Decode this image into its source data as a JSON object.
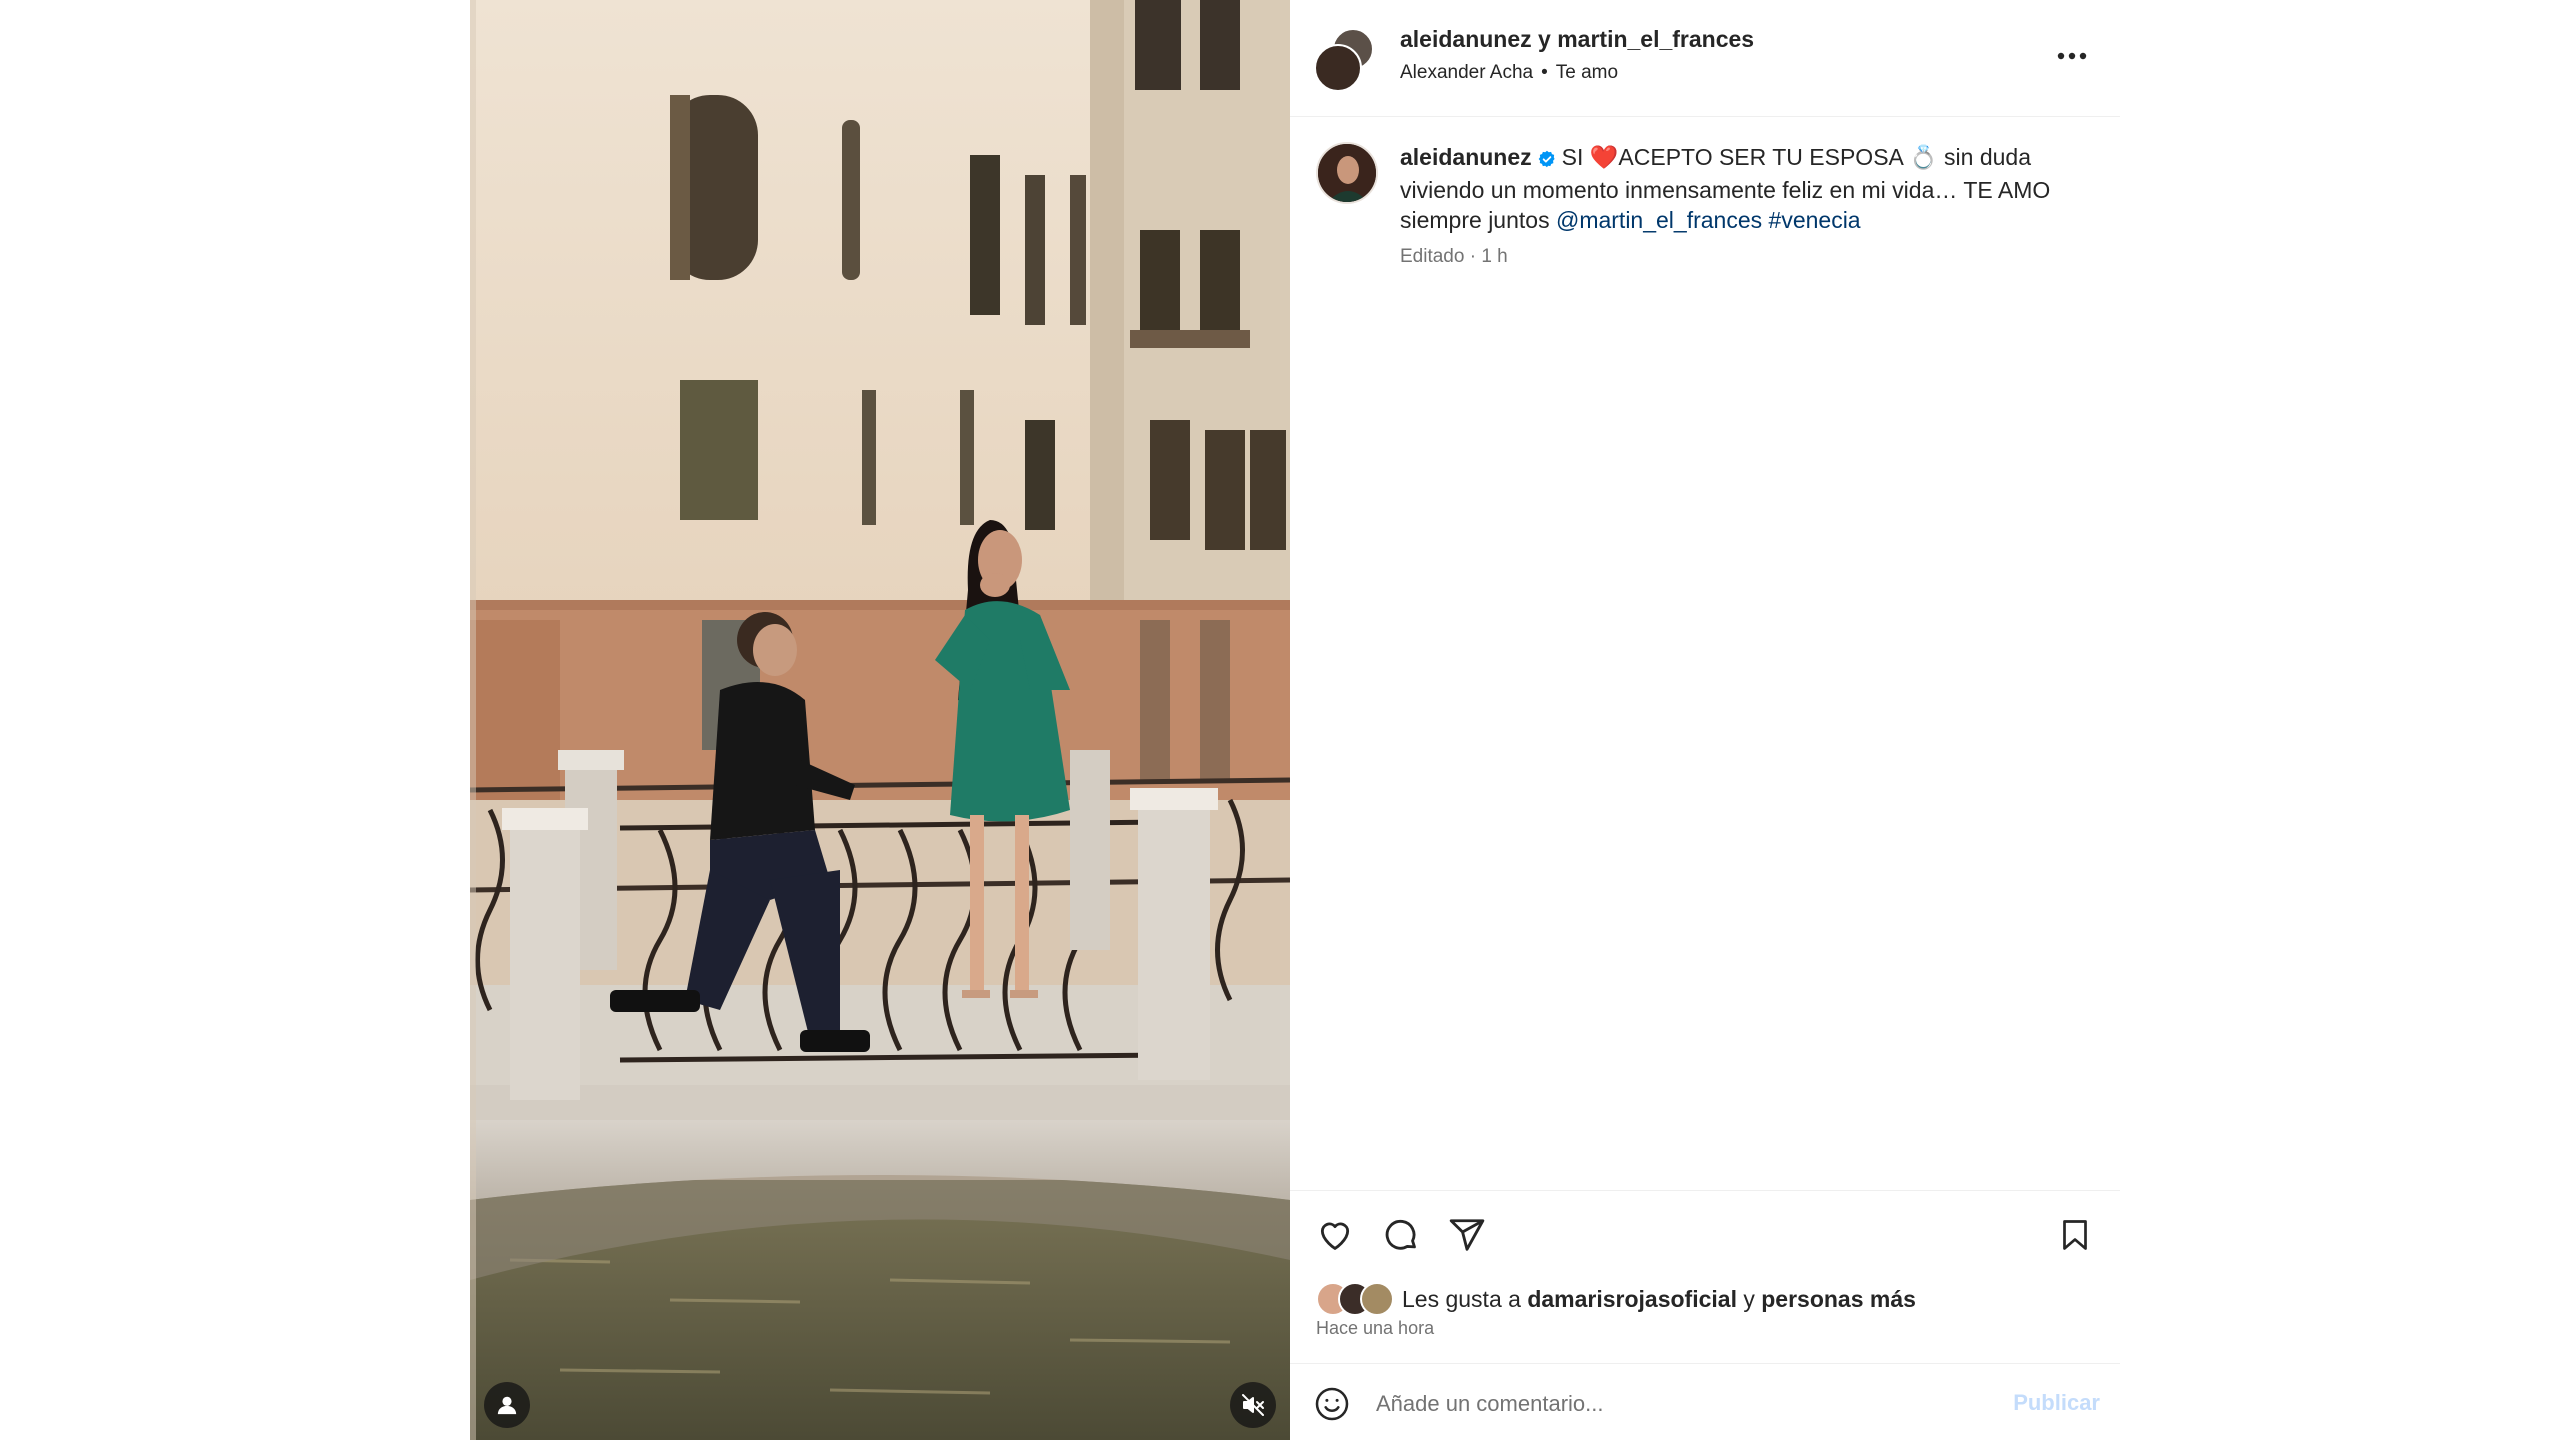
{
  "post": {
    "header": {
      "users": "aleidanunez y martin_el_frances",
      "audio_artist": "Alexander Acha",
      "separator": "•",
      "audio_track": "Te amo"
    },
    "caption": {
      "username": "aleidanunez",
      "text_1": "SI",
      "heart_emoji": "❤️",
      "text_2": "ACEPTO SER TU ESPOSA",
      "ring_emoji": "💍",
      "text_3": "sin duda viviendo un momento inmensamente feliz en mi vida… TE AMO siempre juntos",
      "mention": "@martin_el_frances",
      "hashtag": "#venecia",
      "meta": "Editado · 1 h"
    },
    "likes": {
      "prefix": "Les gusta a",
      "liker": "damarisrojasoficial",
      "joiner": "y",
      "others": "personas más"
    },
    "time_ago": "Hace una hora",
    "comment": {
      "placeholder": "Añade un comentario...",
      "publish_label": "Publicar"
    },
    "icons": {
      "more": "more-horizontal-icon",
      "like": "heart-icon",
      "comment": "comment-bubble-icon",
      "share": "paper-plane-icon",
      "save": "bookmark-icon",
      "emoji": "smiley-icon",
      "tagged": "person-icon",
      "mute": "speaker-muted-icon",
      "verified": "verified-badge-icon"
    },
    "colors": {
      "link": "#00376b",
      "verified": "#0095f6",
      "publish_disabled": "#c4dcfb",
      "secondary_text": "#737373"
    }
  }
}
